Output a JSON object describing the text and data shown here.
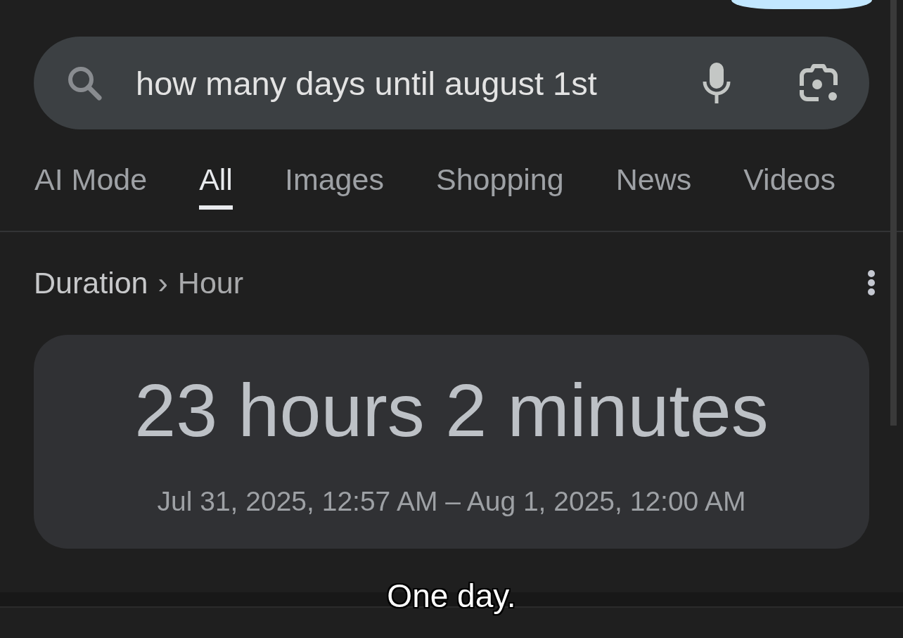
{
  "search": {
    "value": "how many days until august 1st"
  },
  "tabs": [
    {
      "label": "AI Mode",
      "selected": false
    },
    {
      "label": "All",
      "selected": true
    },
    {
      "label": "Images",
      "selected": false
    },
    {
      "label": "Shopping",
      "selected": false
    },
    {
      "label": "News",
      "selected": false
    },
    {
      "label": "Videos",
      "selected": false
    }
  ],
  "breadcrumb": {
    "items": [
      "Duration",
      "Hour"
    ],
    "separator": "›"
  },
  "result": {
    "duration": "23 hours 2 minutes",
    "range": "Jul 31, 2025, 12:57 AM – Aug 1, 2025, 12:00 AM"
  },
  "caption": "One day."
}
